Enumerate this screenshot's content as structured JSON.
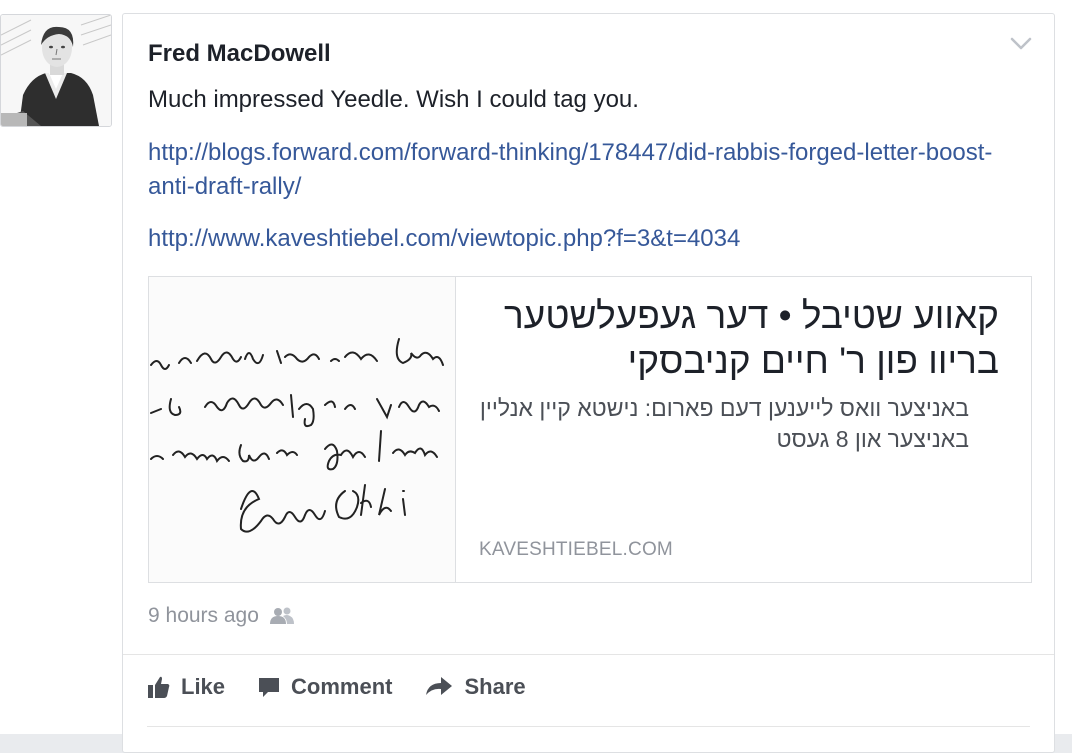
{
  "post": {
    "author": "Fred MacDowell",
    "text": "Much impressed Yeedle. Wish I could tag you.",
    "links": [
      "http://blogs.forward.com/forward-thinking/178447/did-rabbis-forged-letter-boost-anti-draft-rally/",
      "http://www.kaveshtiebel.com/viewtopic.php?f=3&t=4034"
    ],
    "preview": {
      "title": "קאווע שטיבל • דער געפעלשטער בריוו פון ר' חיים קניבסקי",
      "description": "באניצער וואס לייענען דעם פארום: נישטא קיין אנליין באניצער און 8 געסט",
      "domain": "KAVESHTIEBEL.COM"
    },
    "timestamp": "9 hours ago",
    "privacy_icon": "friends-icon",
    "actions": {
      "like": "Like",
      "comment": "Comment",
      "share": "Share"
    }
  },
  "colors": {
    "link": "#365899",
    "text": "#1d2129",
    "meta": "#90949c",
    "action": "#4b4f56"
  }
}
